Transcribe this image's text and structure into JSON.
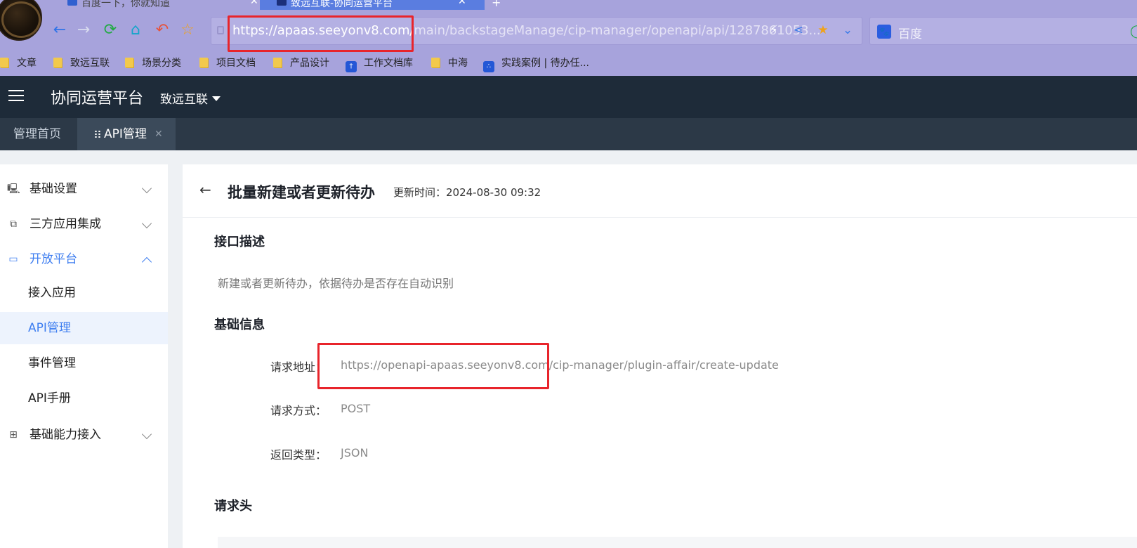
{
  "browser": {
    "tabs": [
      {
        "label": "百度一下，你就知道",
        "close": "✕"
      },
      {
        "label": "致远互联-协同运营平台",
        "close": "✕"
      }
    ],
    "new_tab": "+",
    "url": {
      "main": "https://apaas.seeyonv8.com/",
      "rest": "main/backstageManage/cip-manager/openapi/api/1287861053..."
    },
    "search": {
      "engine": "百度",
      "logo": "🐾"
    },
    "bookmarks": [
      "文章",
      "致远互联",
      "场景分类",
      "项目文档",
      "产品设计",
      "工作文档库",
      "中海",
      "实践案例 | 待办任..."
    ]
  },
  "header": {
    "app_title": "协同运营平台",
    "org": "致远互联"
  },
  "page_tabs": {
    "home": "管理首页",
    "api": "API管理",
    "close": "✕"
  },
  "sidebar": {
    "items": [
      {
        "label": "基础设置",
        "icon": "settings-monitor-icon"
      },
      {
        "label": "三方应用集成",
        "icon": "integration-icon"
      },
      {
        "label": "开放平台",
        "icon": "monitor-icon"
      },
      {
        "label": "基础能力接入",
        "icon": "sliders-icon"
      }
    ],
    "sub_items": [
      "接入应用",
      "API管理",
      "事件管理",
      "API手册"
    ]
  },
  "detail": {
    "title": "批量新建或者更新待办",
    "update_time": "更新时间：2024-08-30 09:32",
    "desc_title": "接口描述",
    "desc_text": "新建或者更新待办，依据待办是否存在自动识别",
    "basic_title": "基础信息",
    "fields": [
      {
        "label": "请求地址：",
        "value": "https://openapi-apaas.seeyonv8.com/cip-manager/plugin-affair/create-update"
      },
      {
        "label": "请求方式：",
        "value": "POST"
      },
      {
        "label": "返回类型：",
        "value": "JSON"
      }
    ],
    "headers_title": "请求头"
  },
  "colors": {
    "accent": "#3e7ef0",
    "header_bg": "#1e2b39",
    "highlight": "#e8242b",
    "browser_bg": "#a7a3dc"
  }
}
